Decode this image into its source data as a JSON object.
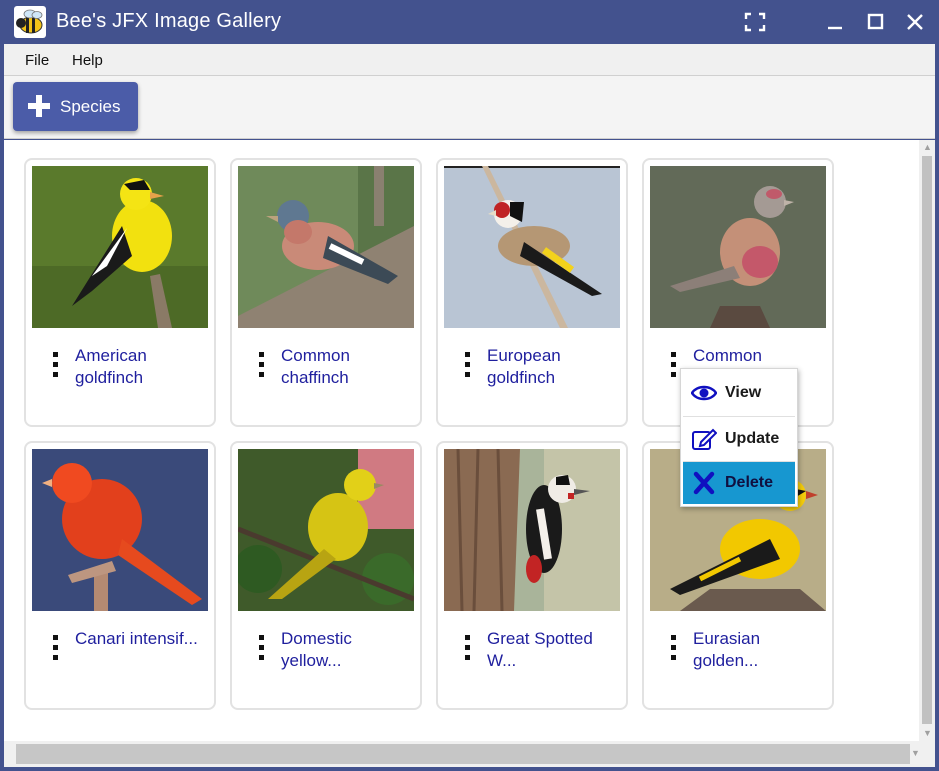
{
  "window": {
    "title": "Bee's JFX Image Gallery",
    "controls": [
      "fullscreen-icon",
      "minimize-icon",
      "maximize-icon",
      "close-icon"
    ]
  },
  "menu": {
    "file": "File",
    "help": "Help"
  },
  "toolbar": {
    "species_label": "Species",
    "species_icon": "plus-icon"
  },
  "cards": [
    {
      "name": "American goldfinch"
    },
    {
      "name": "Common chaffinch"
    },
    {
      "name": "European goldfinch"
    },
    {
      "name": "Common"
    },
    {
      "name": "Canari intensif..."
    },
    {
      "name": "Domestic yellow..."
    },
    {
      "name": "Great Spotted W..."
    },
    {
      "name": "Eurasian golden..."
    }
  ],
  "context_menu": {
    "items": [
      {
        "label": "View",
        "icon": "eye-icon"
      },
      {
        "label": "Update",
        "icon": "edit-icon"
      },
      {
        "label": "Delete",
        "icon": "x-icon",
        "highlighted": true
      }
    ]
  },
  "colors": {
    "titlebar": "#43528e",
    "accent_button": "#4b5ca8",
    "card_text": "#1f1f9e",
    "highlight": "#1797d0"
  }
}
